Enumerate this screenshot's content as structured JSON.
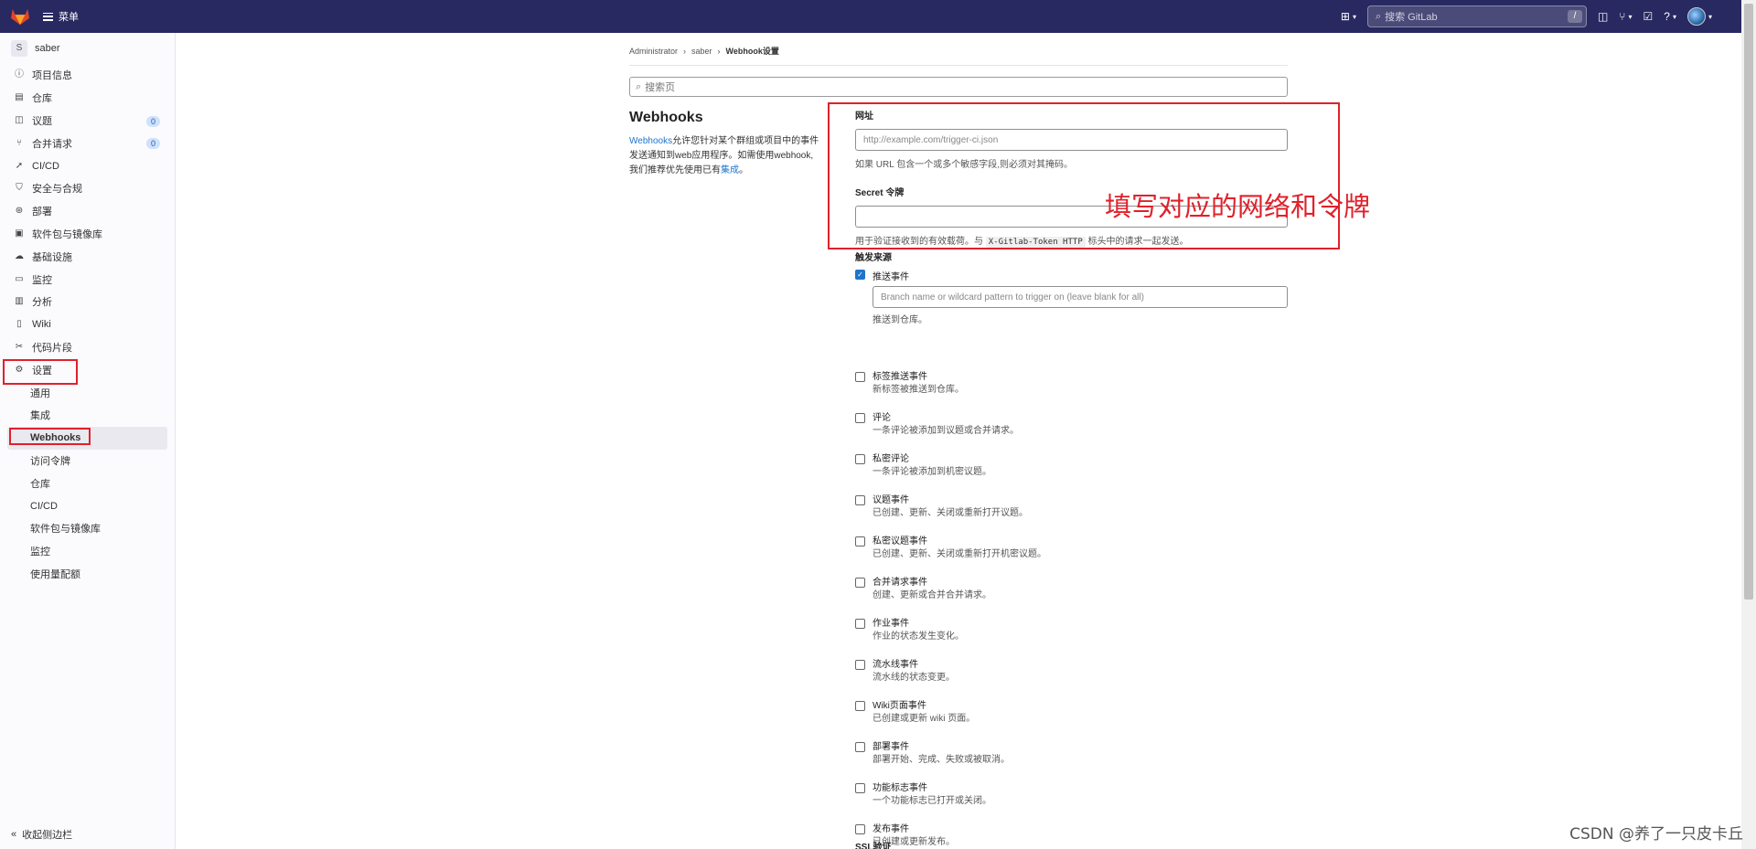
{
  "topbar": {
    "menu_label": "菜单",
    "search_placeholder": "搜索 GitLab",
    "search_shortcut": "/"
  },
  "sidebar": {
    "project_initial": "S",
    "project_name": "saber",
    "items": [
      {
        "label": "项目信息",
        "icon": "info-icon"
      },
      {
        "label": "仓库",
        "icon": "doc-icon"
      },
      {
        "label": "议题",
        "icon": "issues-icon",
        "count": "0"
      },
      {
        "label": "合并请求",
        "icon": "merge-icon",
        "count": "0"
      },
      {
        "label": "CI/CD",
        "icon": "rocket-icon"
      },
      {
        "label": "安全与合规",
        "icon": "shield-icon"
      },
      {
        "label": "部署",
        "icon": "deploy-icon"
      },
      {
        "label": "软件包与镜像库",
        "icon": "package-icon"
      },
      {
        "label": "基础设施",
        "icon": "cloud-icon"
      },
      {
        "label": "监控",
        "icon": "monitor-icon"
      },
      {
        "label": "分析",
        "icon": "chart-icon"
      },
      {
        "label": "Wiki",
        "icon": "book-icon"
      },
      {
        "label": "代码片段",
        "icon": "scissors-icon"
      },
      {
        "label": "设置",
        "icon": "gear-icon"
      }
    ],
    "settings_sub": [
      "通用",
      "集成",
      "Webhooks",
      "访问令牌",
      "仓库",
      "CI/CD",
      "软件包与镜像库",
      "监控",
      "使用量配额"
    ],
    "collapse_label": "收起侧边栏"
  },
  "breadcrumb": [
    "Administrator",
    "saber",
    "Webhook设置"
  ],
  "settings_search_placeholder": "搜索页",
  "webhooks": {
    "title": "Webhooks",
    "desc_link1": "Webhooks",
    "desc_text1": "允许您针对某个群组或项目中的事件",
    "desc_text2": "发送通知到web应用程序。如需使用webhook,",
    "desc_text3": "我们推荐优先使用已有",
    "desc_link2": "集成",
    "desc_text4": "。"
  },
  "form": {
    "url_label": "网址",
    "url_placeholder": "http://example.com/trigger-ci.json",
    "url_help": "如果 URL 包含一个或多个敏感字段,则必须对其掩码。",
    "secret_label": "Secret 令牌",
    "secret_help_pre": "用于验证接收到的有效载荷。与",
    "secret_help_code": "X-Gitlab-Token HTTP",
    "secret_help_post": "标头中的请求一起发送。",
    "trigger_title": "触发来源",
    "push_label": "推送事件",
    "branch_placeholder": "Branch name or wildcard pattern to trigger on (leave blank for all)",
    "push_help": "推送到仓库。",
    "events": [
      {
        "title": "标签推送事件",
        "desc": "新标签被推送到仓库。"
      },
      {
        "title": "评论",
        "desc": "一条评论被添加到议题或合并请求。"
      },
      {
        "title": "私密评论",
        "desc": "一条评论被添加到机密议题。"
      },
      {
        "title": "议题事件",
        "desc": "已创建、更新、关闭或重新打开议题。"
      },
      {
        "title": "私密议题事件",
        "desc": "已创建、更新、关闭或重新打开机密议题。"
      },
      {
        "title": "合并请求事件",
        "desc": "创建、更新或合并合并请求。"
      },
      {
        "title": "作业事件",
        "desc": "作业的状态发生变化。"
      },
      {
        "title": "流水线事件",
        "desc": "流水线的状态变更。"
      },
      {
        "title": "Wiki页面事件",
        "desc": "已创建或更新 wiki 页面。"
      },
      {
        "title": "部署事件",
        "desc": "部署开始、完成、失败或被取消。"
      },
      {
        "title": "功能标志事件",
        "desc": "一个功能标志已打开或关闭。"
      },
      {
        "title": "发布事件",
        "desc": "已创建或更新发布。"
      }
    ],
    "ssl_label": "SSL验证"
  },
  "annotation_text": "填写对应的网络和令牌",
  "watermark": "CSDN @养了一只皮卡丘",
  "colors": {
    "topbar": "#292961",
    "link": "#1f75cb",
    "annotation": "#e0212b"
  }
}
